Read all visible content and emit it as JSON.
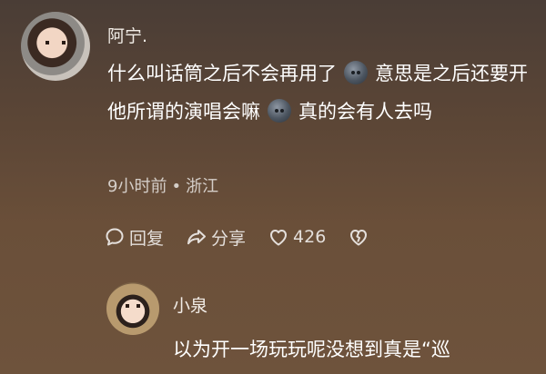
{
  "comment": {
    "username": "阿宁.",
    "text_parts": [
      "什么叫话筒之后不会再用了",
      "意思是之后还要开他所谓的演唱会嘛",
      "真的会有人去吗"
    ],
    "emoji_name": "dark-face-emoji",
    "time": "9小时前",
    "separator": "•",
    "location": "浙江",
    "actions": {
      "reply_label": "回复",
      "share_label": "分享",
      "like_count": "426"
    }
  },
  "reply": {
    "username": "小泉",
    "text": "以为开一场玩玩呢没想到真是“巡"
  },
  "colors": {
    "background_top": "#4a3d36",
    "background_bottom": "#6e533c",
    "text": "#ffffff",
    "meta_text": "#bdb5ad"
  }
}
